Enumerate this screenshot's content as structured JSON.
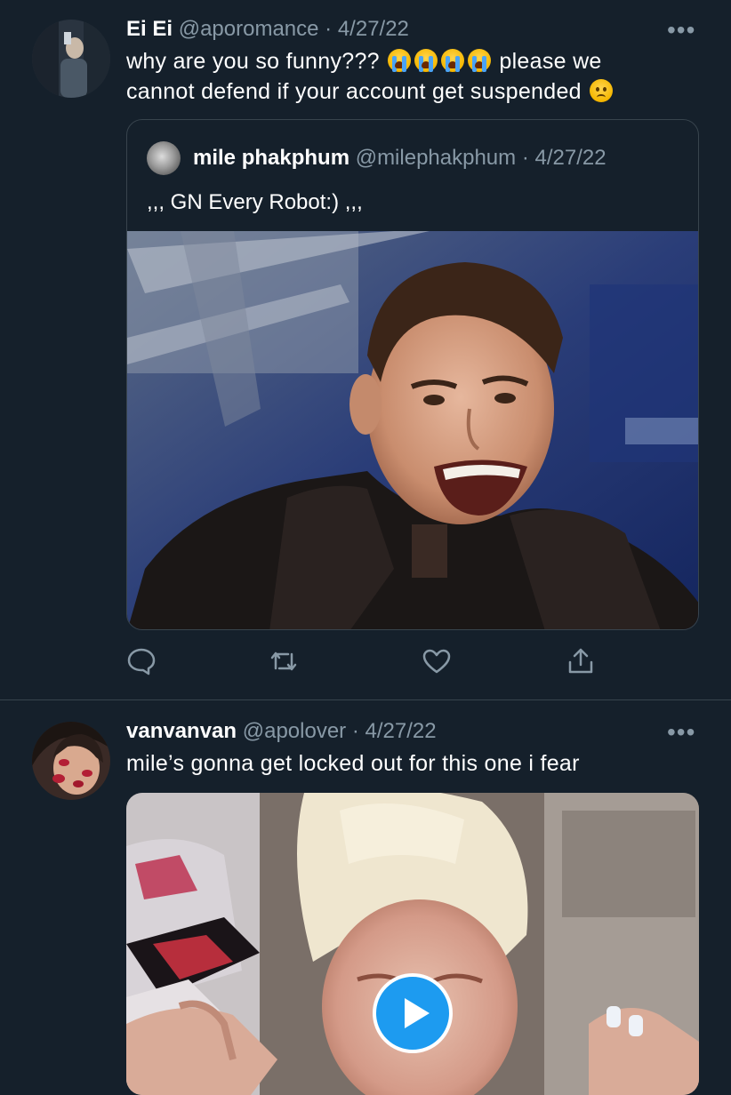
{
  "tweets": [
    {
      "display_name": "Ei Ei",
      "handle": "@aporomance",
      "separator": "·",
      "date": "4/27/22",
      "more_label": "•••",
      "text_part1": "why are you so funny???",
      "text_part2": "please we",
      "text_part3": "cannot defend if your account get suspended",
      "emojis": [
        "loudly-crying-face",
        "loudly-crying-face",
        "loudly-crying-face",
        "loudly-crying-face",
        "worried-face"
      ],
      "quoted": {
        "display_name": "mile phakphum",
        "handle": "@milephakphum",
        "separator": "·",
        "date": "4/27/22",
        "text": ",,, GN Every Robot:) ,,,"
      },
      "actions": [
        "reply-icon",
        "retweet-icon",
        "like-icon",
        "share-icon"
      ]
    },
    {
      "display_name": "vanvanvan",
      "handle": "@apolover",
      "separator": "·",
      "date": "4/27/22",
      "more_label": "•••",
      "text": "mile’s gonna get locked out for this one i fear",
      "media_type": "video",
      "play_icon": "play-icon"
    }
  ],
  "colors": {
    "background": "#15202b",
    "secondary_text": "#8899a6",
    "border": "#38444d",
    "accent": "#1d9bf0"
  }
}
